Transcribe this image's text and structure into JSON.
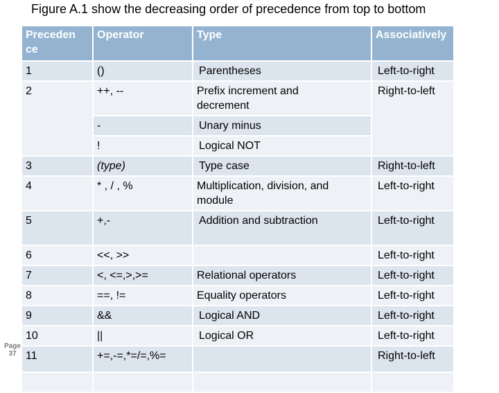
{
  "title": "Figure A.1 show the decreasing order of precedence from top to bottom",
  "page_label": {
    "line1": "Page",
    "line2": "37"
  },
  "table": {
    "headers": [
      "Preceden ce",
      "Operator",
      "Type",
      "Associatively"
    ],
    "rows": [
      {
        "precedence": "1",
        "operator": "()",
        "type": "Parentheses",
        "assoc": "Left-to-right"
      },
      {
        "precedence": "2",
        "operator": "++, --",
        "type": "Prefix increment and\n decrement",
        "assoc": "Right-to-left"
      },
      {
        "precedence": "",
        "operator": "-",
        "type": "Unary minus",
        "assoc": ""
      },
      {
        "precedence": "",
        "operator": "!",
        "type": "Logical NOT",
        "assoc": ""
      },
      {
        "precedence": "3",
        "operator": "(type)",
        "type": "Type case",
        "assoc": "Right-to-left"
      },
      {
        "precedence": "4",
        "operator": "* , / , %",
        "type": "Multiplication, division, and\n module",
        "assoc": "Left-to-right"
      },
      {
        "precedence": "5",
        "operator": "+,-",
        "type": "Addition and subtraction",
        "assoc": "Left-to-right"
      },
      {
        "precedence": "6",
        "operator": "<<, >>",
        "type": "",
        "assoc": "Left-to-right"
      },
      {
        "precedence": "7",
        "operator": "<, <=,>,>=",
        "type": "Relational operators",
        "assoc": "Left-to-right"
      },
      {
        "precedence": "8",
        "operator": "==, !=",
        "type": "Equality operators",
        "assoc": "Left-to-right"
      },
      {
        "precedence": "9",
        "operator": "&&",
        "type": "Logical AND",
        "assoc": "Left-to-right"
      },
      {
        "precedence": "10",
        "operator": "||",
        "type": "Logical OR",
        "assoc": "Left-to-right"
      },
      {
        "precedence": "11",
        "operator": "+=,-=,*=/=,%=",
        "type": "",
        "assoc": "Right-to-left"
      },
      {
        "precedence": "",
        "operator": "",
        "type": "",
        "assoc": ""
      }
    ]
  },
  "colors": {
    "header_bg": "#93b3d1",
    "row_dark": "#dce4ed",
    "row_light": "#eef1f6"
  }
}
